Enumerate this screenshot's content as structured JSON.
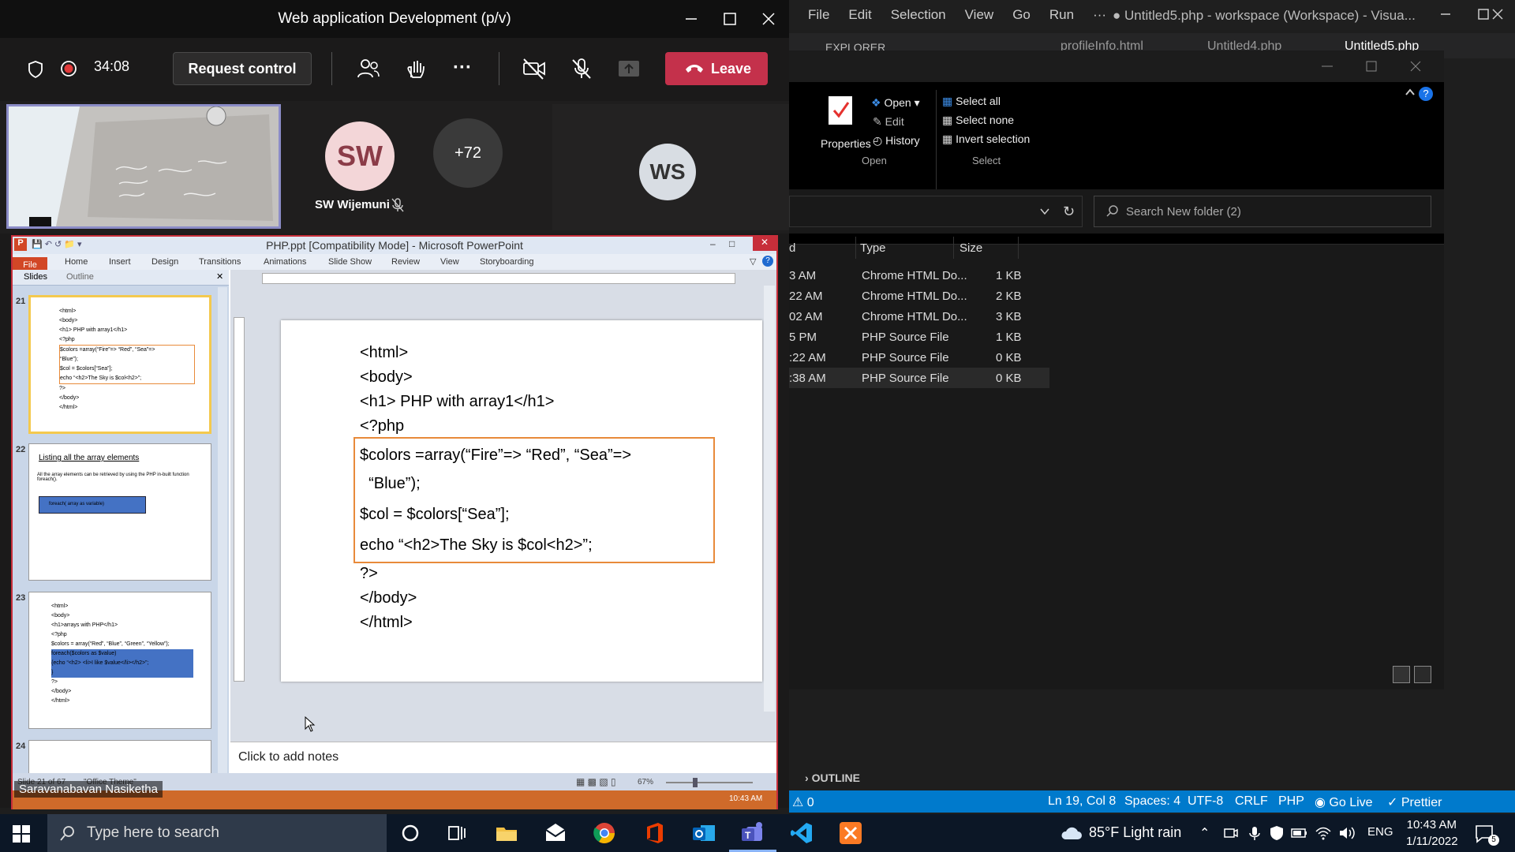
{
  "vscode": {
    "menu": [
      "File",
      "Edit",
      "Selection",
      "View",
      "Go",
      "Run",
      "···"
    ],
    "title": "● Untitled5.php - workspace (Workspace) - Visua...",
    "explorer_label": "EXPLORER",
    "tabs": [
      "profileInfo.html",
      "Untitled4.php",
      "Untitled5.php"
    ],
    "outline_label": "OUTLINE",
    "status": {
      "problems": "0",
      "position": "Ln 19, Col 8",
      "spaces": "Spaces: 4",
      "encoding": "UTF-8",
      "eol": "CRLF",
      "language": "PHP",
      "golive": "Go Live",
      "prettier": "Prettier"
    }
  },
  "explorer": {
    "ribbon": {
      "properties": "Properties",
      "open": "Open",
      "edit": "Edit",
      "history": "History",
      "select_all": "Select all",
      "select_none": "Select none",
      "invert_selection": "Invert selection",
      "group_open": "Open",
      "group_select": "Select"
    },
    "search_placeholder": "Search New folder (2)",
    "columns": {
      "date": "d",
      "type": "Type",
      "size": "Size"
    },
    "rows": [
      {
        "date": "3 AM",
        "type": "Chrome HTML Do...",
        "size": "1 KB"
      },
      {
        "date": "22 AM",
        "type": "Chrome HTML Do...",
        "size": "2 KB"
      },
      {
        "date": "02 AM",
        "type": "Chrome HTML Do...",
        "size": "3 KB"
      },
      {
        "date": "5 PM",
        "type": "PHP Source File",
        "size": "1 KB"
      },
      {
        "date": ":22 AM",
        "type": "PHP Source File",
        "size": "0 KB"
      },
      {
        "date": ":38 AM",
        "type": "PHP Source File",
        "size": "0 KB"
      }
    ]
  },
  "teams": {
    "title": "Web application Development (p/v)",
    "timer": "34:08",
    "request_control": "Request control",
    "leave": "Leave",
    "participants": {
      "sw_initials": "SW",
      "sw_name": "SW Wijemuni",
      "more_count": "+72",
      "ws_initials": "WS"
    },
    "presenter_name": "Saravanabavan Nasiketha"
  },
  "powerpoint": {
    "title": "PHP.ppt [Compatibility Mode]  -  Microsoft PowerPoint",
    "tabs": [
      "File",
      "Home",
      "Insert",
      "Design",
      "Transitions",
      "Animations",
      "Slide Show",
      "Review",
      "View",
      "Storyboarding"
    ],
    "pane_tabs": [
      "Slides",
      "Outline"
    ],
    "slide_numbers": [
      "21",
      "22",
      "23",
      "24"
    ],
    "thumb21": [
      "<html>",
      "<body>",
      "<h1> PHP with array1</h1>",
      "<?php",
      "$colors =array(“Fire”=> “Red”, “Sea”=>",
      "  “Blue”);",
      "$col = $colors[“Sea”];",
      "echo “<h2>The Sky is $col<h2>”;",
      "?>",
      "</body>",
      "</html>"
    ],
    "thumb22": {
      "title": "Listing  all  the array elements",
      "bullet": "All the array elements can be retrieved by using the PHP in-built function foreach().",
      "box": "foreach( array as variable)"
    },
    "thumb23": [
      "<html>",
      "<body>",
      "<h1>arrays with PHP</h1>",
      "<?php",
      "$colors = array(“Red”, “Blue”, “Green”, “Yellow”);",
      "foreach($colors as $value)",
      "{echo “<h2> <li>I like $value</li></h2>”;",
      "}",
      "?>",
      "</body>",
      "</html>"
    ],
    "slide_code_top": [
      "<html>",
      "<body>",
      "<h1> PHP with array1</h1>",
      "<?php"
    ],
    "slide_code_box": [
      "$colors =array(“Fire”=> “Red”, “Sea”=>",
      "  “Blue”);",
      "$col = $colors[“Sea”];",
      "echo “<h2>The Sky is $col<h2>”;"
    ],
    "slide_code_bottom": [
      "?>",
      "</body>",
      "</html>"
    ],
    "notes_placeholder": "Click to add notes",
    "status": {
      "slide": "Slide 21 of 67",
      "theme": "\"Office Theme\"",
      "zoom": "67%",
      "time": "10:43 AM"
    }
  },
  "taskbar": {
    "search_placeholder": "Type here to search",
    "weather": "85°F  Light rain",
    "lang": "ENG",
    "time": "10:43 AM",
    "date": "1/11/2022",
    "notifications": "5"
  }
}
